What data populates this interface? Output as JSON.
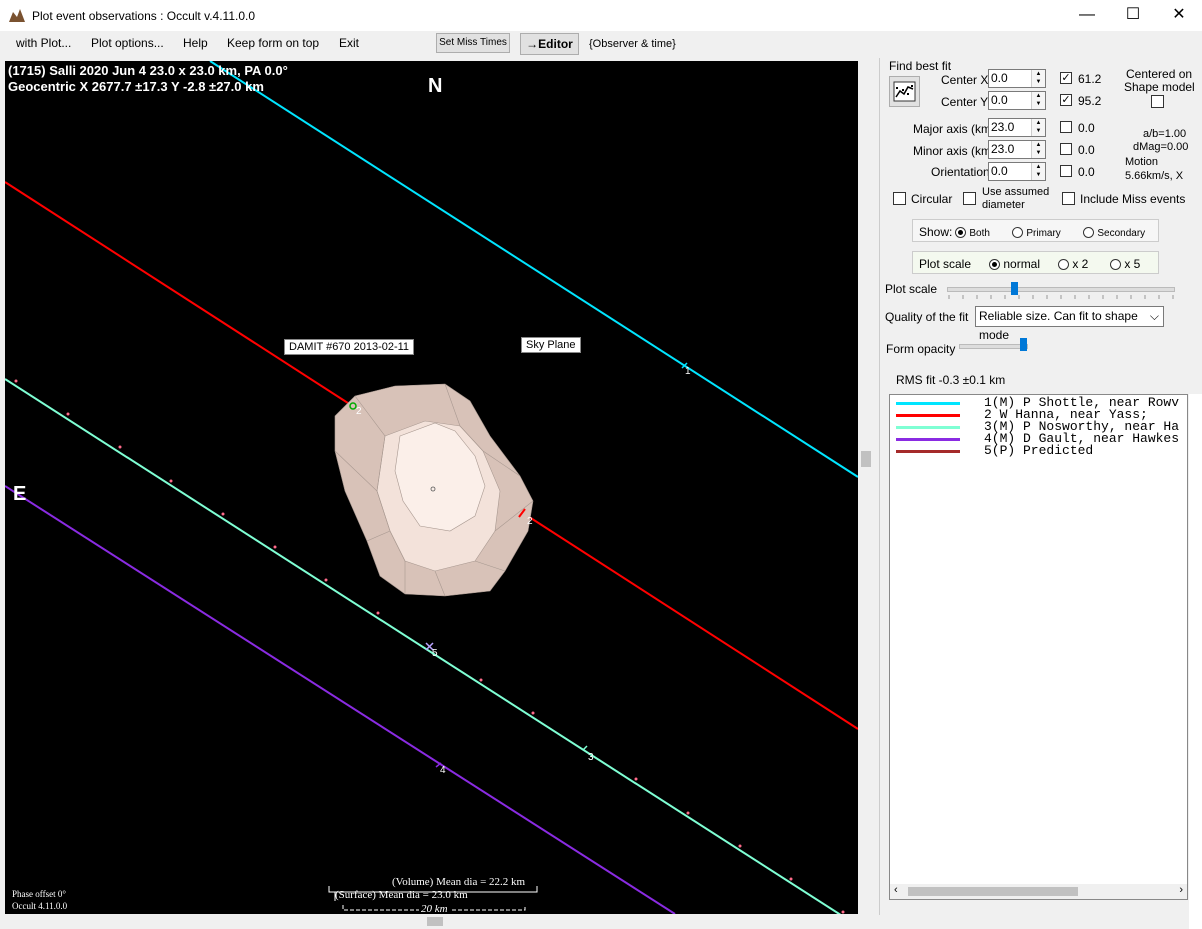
{
  "window": {
    "title": "Plot event observations : Occult v.4.11.0.0",
    "minimize": "—",
    "maximize": "☐",
    "close": "✕"
  },
  "menu": {
    "items": [
      "with Plot...",
      "Plot options...",
      "Help",
      "Keep form on top",
      "Exit"
    ],
    "set_miss_times": "Set Miss Times",
    "editor": "→Editor",
    "observer_time": "{Observer & time}"
  },
  "plot": {
    "header_line1": "(1715) Salli  2020 Jun 4  23.0 x 23.0 km, PA 0.0°",
    "header_line2": "Geocentric  X  2677.7 ±17.3  Y -2.8 ±27.0 km",
    "north": "N",
    "east": "E",
    "damit_label": "DAMIT #670 2013-02-11",
    "sky_plane_label": "Sky Plane",
    "chord_labels": [
      "1",
      "2",
      "2",
      "3",
      "4",
      "5"
    ],
    "volume_dia": "(Volume) Mean dia = 22.2 km",
    "surface_dia": "(Surface) Mean dia = 23.0 km",
    "scale_bar": "20 km",
    "phase_offset": "Phase offset 0°",
    "version": "Occult 4.11.0.0"
  },
  "panel": {
    "find_best_fit": "Find best fit",
    "center_x_label": "Center X",
    "center_x_value": "0.0",
    "center_y_label": "Center Y",
    "center_y_value": "0.0",
    "center_x_chk": "61.2",
    "center_y_chk": "95.2",
    "centered_on": "Centered on",
    "shape_model": "Shape model",
    "major_label": "Major axis (km)",
    "major_value": "23.0",
    "major_chk": "0.0",
    "minor_label": "Minor axis (km)",
    "minor_value": "23.0",
    "minor_chk": "0.0",
    "orient_label": "Orientation",
    "orient_value": "0.0",
    "orient_chk": "0.0",
    "ab": "a/b=1.00",
    "dmag": "dMag=0.00",
    "motion": "Motion",
    "motion_val": "5.66km/s, X",
    "circular": "Circular",
    "use_assumed": "Use assumed",
    "diameter": "diameter",
    "include_miss": "Include Miss events",
    "show_label": "Show:",
    "show_both": "Both",
    "show_primary": "Primary",
    "show_secondary": "Secondary",
    "plot_scale_label": "Plot scale",
    "scale_normal": "normal",
    "scale_x2": "x 2",
    "scale_x5": "x 5",
    "plot_scale_slider": "Plot scale",
    "quality_label": "Quality of the fit",
    "quality_value": "Reliable size. Can fit to shape mode",
    "form_opacity": "Form opacity",
    "rms_fit": "RMS fit -0.3 ±0.1 km"
  },
  "legend": [
    {
      "color": "#00e5ff",
      "text": "1(M)  P Shottle, near Rowv"
    },
    {
      "color": "#ff0000",
      "text": "2     W Hanna, near Yass;"
    },
    {
      "color": "#7fffd4",
      "text": "3(M)  P Nosworthy, near Ha"
    },
    {
      "color": "#8a2be2",
      "text": "4(M)  D Gault, near Hawkes"
    },
    {
      "color": "#a52a2a",
      "text": "5(P)  Predicted"
    }
  ]
}
